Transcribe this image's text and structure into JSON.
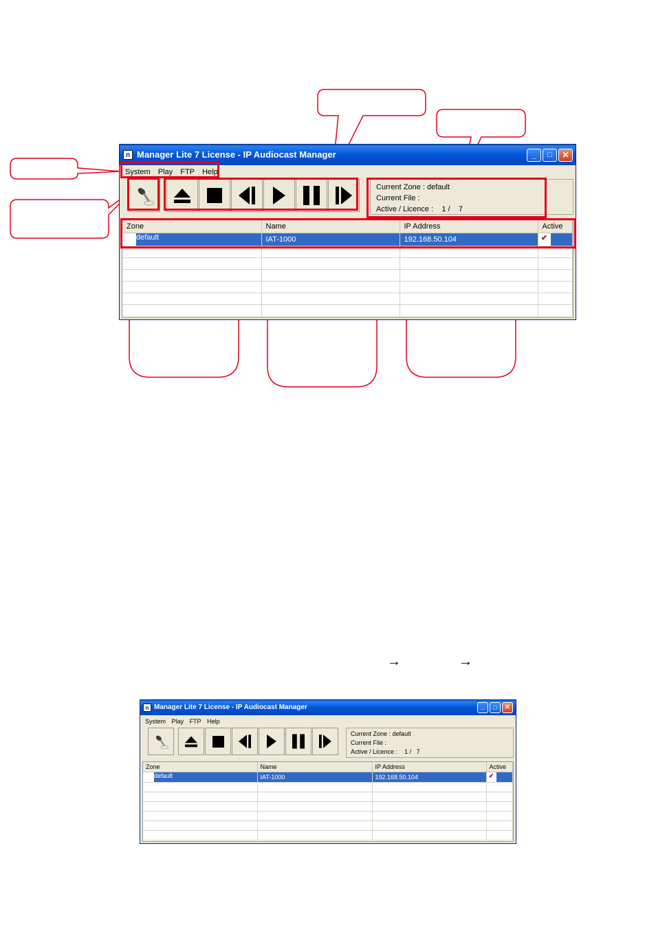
{
  "window_title": "Manager Lite 7 License - IP Audiocast Manager",
  "menu": [
    "System",
    "Play",
    "FTP",
    "Help"
  ],
  "status": {
    "zone_label": "Current Zone :",
    "zone_value": "default",
    "file_label": "Current File :",
    "file_value": "",
    "licence_label": "Active / Licence :",
    "licence_active": "1 /",
    "licence_total": "7"
  },
  "grid": {
    "columns": [
      "Zone",
      "Name",
      "IP Address",
      "Active"
    ],
    "rows": [
      {
        "zone": "default",
        "name": "IAT-1000",
        "ip": "192.168.50.104",
        "active": true
      }
    ]
  },
  "toolbar_icons": [
    "microphone-icon",
    "eject-icon",
    "stop-icon",
    "previous-icon",
    "play-icon",
    "pause-icon",
    "next-icon"
  ],
  "arrows": [
    "→",
    "→"
  ],
  "colors": {
    "title_bar": "#0454d6",
    "selection": "#316ac5",
    "highlight": "#e0001a",
    "check": "#8b1a3c"
  }
}
